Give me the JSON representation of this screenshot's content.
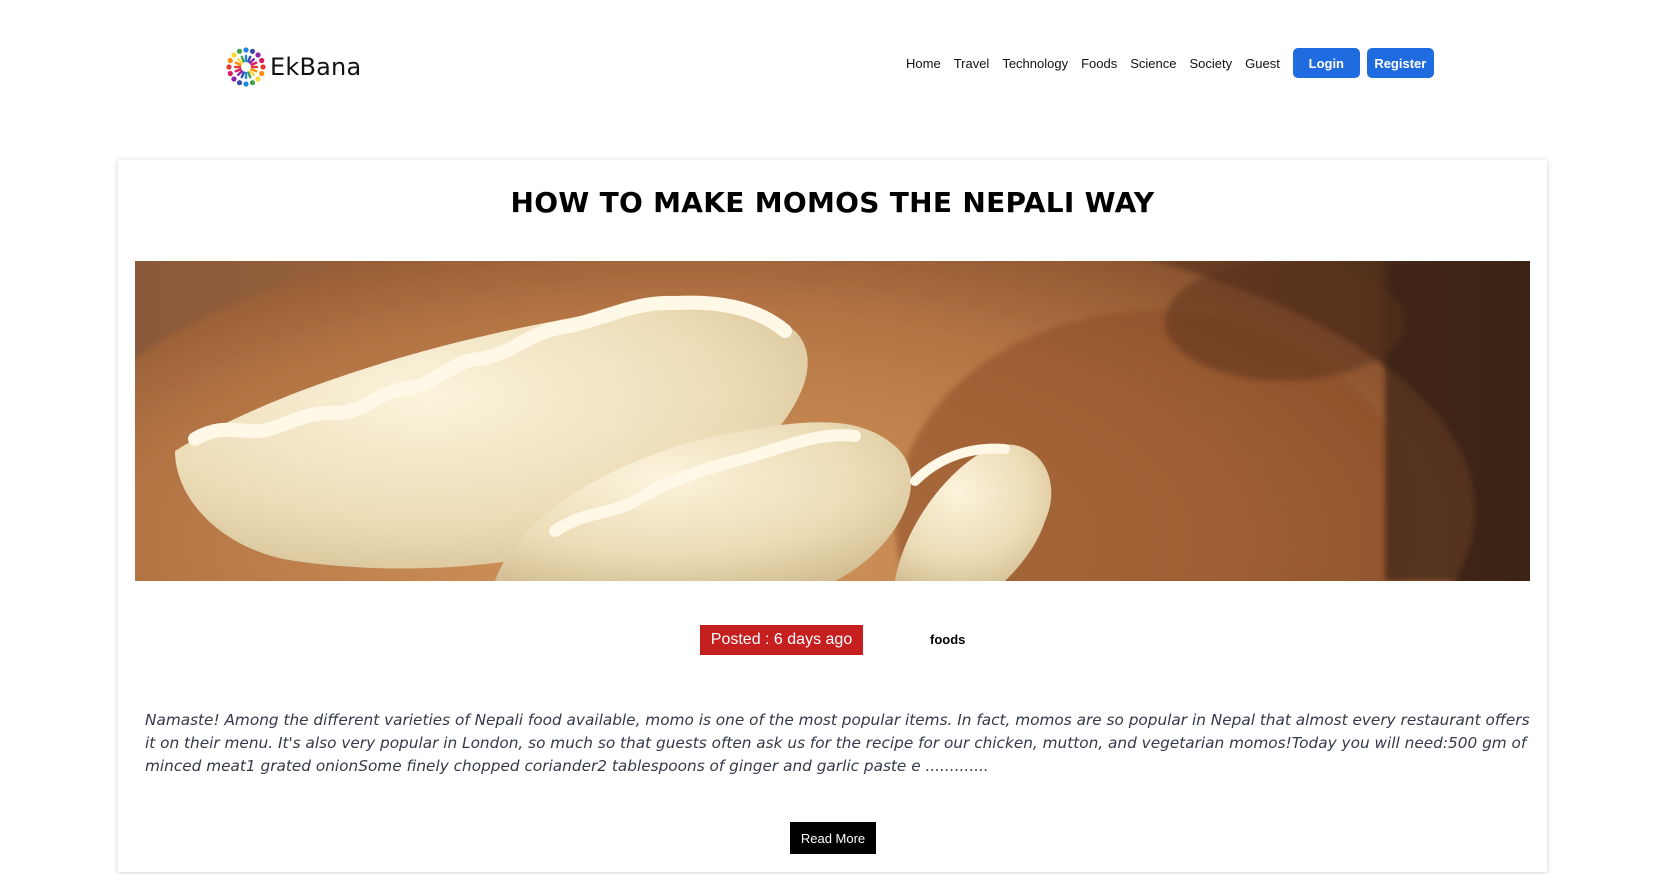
{
  "brand": {
    "name": "EkBana",
    "logo_icon": "colorful-people-circle-logo",
    "logo_colors": [
      "#e53935",
      "#fb8c00",
      "#fdd835",
      "#43a047",
      "#1e88e5",
      "#3949ab",
      "#8e24aa",
      "#d81b60"
    ]
  },
  "nav": {
    "links": [
      "Home",
      "Travel",
      "Technology",
      "Foods",
      "Science",
      "Society",
      "Guest"
    ],
    "login_label": "Login",
    "register_label": "Register",
    "button_color": "#1f6be0"
  },
  "article": {
    "title": "HOW TO MAKE MOMOS THE NEPALI WAY",
    "image_subject": "momos-dumplings-on-wooden-plate",
    "posted": "Posted : 6 days ago",
    "posted_badge_color": "#c51f1f",
    "category": "foods",
    "excerpt": "Namaste! Among the different varieties of Nepali food available, momo is one of the most popular items. In fact, momos are so popular in Nepal that almost every restaurant offers it on their menu. It's also very popular in London, so much so that guests often ask us for the recipe for our chicken, mutton, and vegetarian momos!Today you will need:500 gm of minced meat1 grated onionSome finely chopped coriander2 tablespoons of ginger and garlic paste e .............",
    "read_more_label": "Read More"
  }
}
